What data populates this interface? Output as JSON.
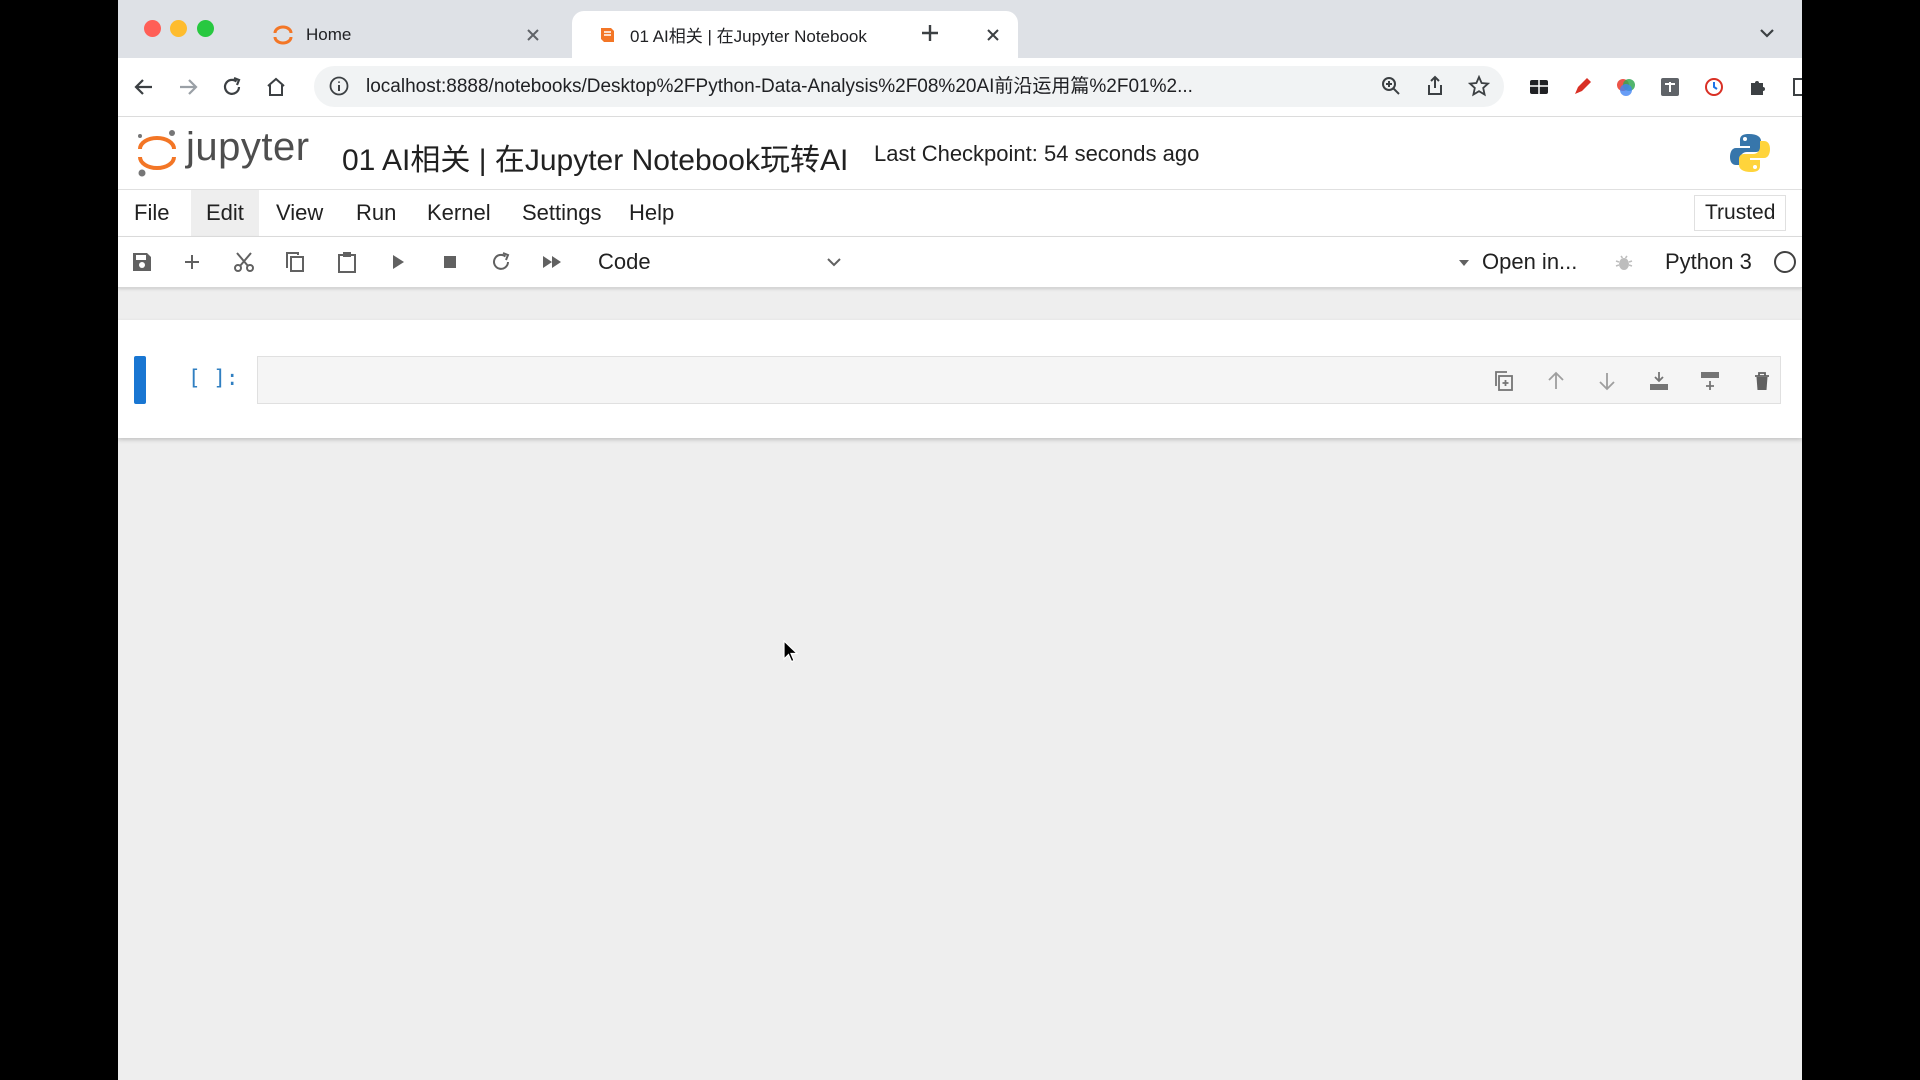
{
  "browser": {
    "tabs": [
      {
        "title": "Home",
        "active": false
      },
      {
        "title": "01 AI相关 | 在Jupyter Notebook",
        "active": true
      }
    ],
    "url": "localhost:8888/notebooks/Desktop%2FPython-Data-Analysis%2F08%20AI前沿运用篇%2F01%2...",
    "icons": [
      "back-icon",
      "forward-icon",
      "reload-icon",
      "home-icon",
      "info-icon",
      "zoom-icon",
      "share-icon",
      "star-icon",
      "extension-icons",
      "puzzle-icon",
      "sidepanel-icon",
      "profile-avatar",
      "kebab-menu-icon"
    ]
  },
  "jupyter": {
    "logo_text": "jupyter",
    "notebook_title": "01 AI相关 | 在Jupyter Notebook玩转AI",
    "checkpoint": "Last Checkpoint: 54 seconds ago",
    "menu": [
      "File",
      "Edit",
      "View",
      "Run",
      "Kernel",
      "Settings",
      "Help"
    ],
    "active_menu": "Edit",
    "trusted_label": "Trusted",
    "toolbar": {
      "cell_type": "Code",
      "open_in": "Open in...",
      "kernel_name": "Python 3"
    },
    "cell": {
      "prompt": "[ ]:",
      "source": ""
    }
  },
  "colors": {
    "jupyter_orange": "#f37626",
    "cell_active": "#1976d2",
    "prompt_blue": "#307fc1",
    "tab_strip": "#dee1e6"
  }
}
